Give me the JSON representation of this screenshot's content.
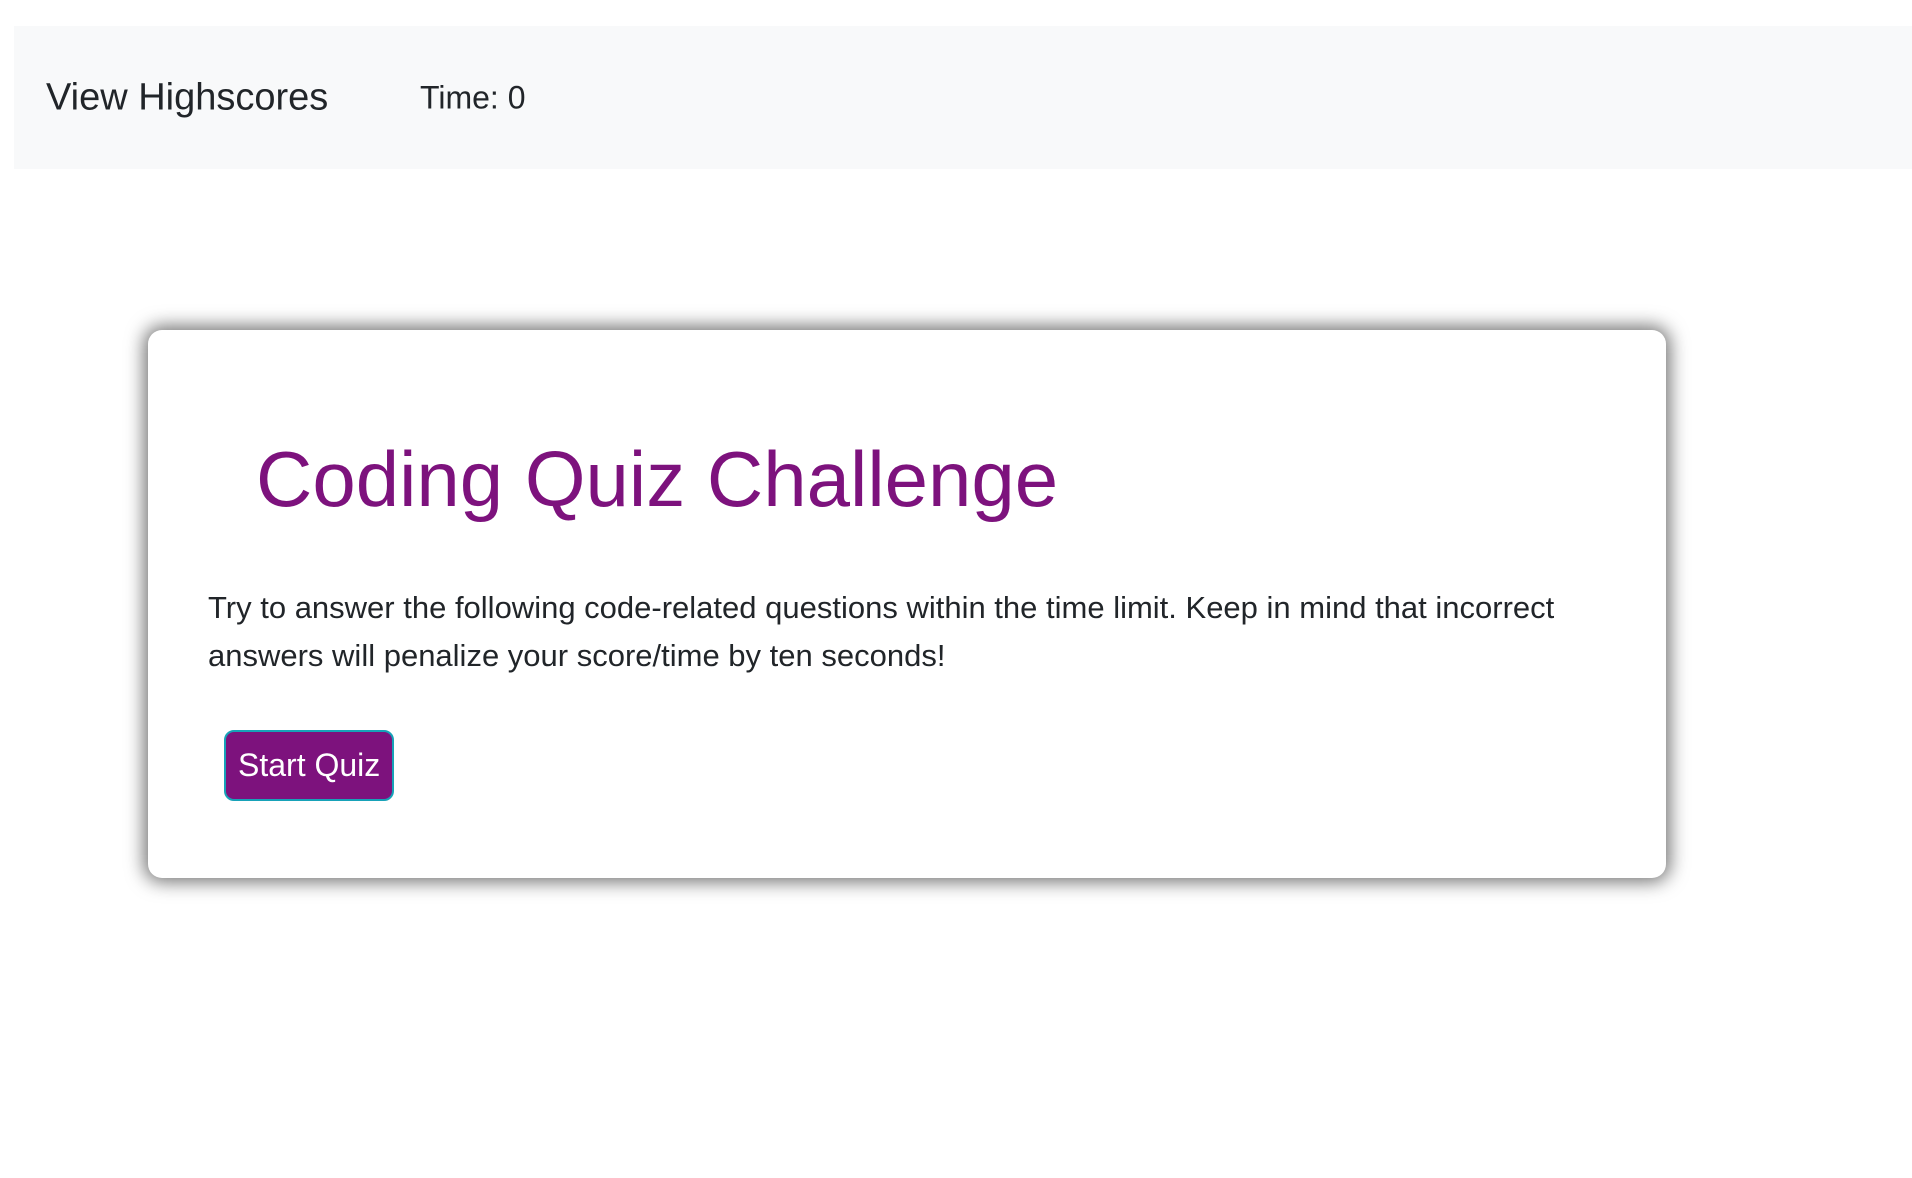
{
  "navbar": {
    "highscores_label": "View Highscores",
    "timer_text": "Time: 0"
  },
  "card": {
    "title": "Coding Quiz Challenge",
    "description": "Try to answer the following code-related questions within the time limit. Keep in mind that incorrect answers will penalize your score/time by ten seconds!",
    "start_button_label": "Start Quiz"
  },
  "colors": {
    "accent": "#7d127d",
    "navbar_bg": "#f8f9fa",
    "button_border": "#17a2b8"
  }
}
